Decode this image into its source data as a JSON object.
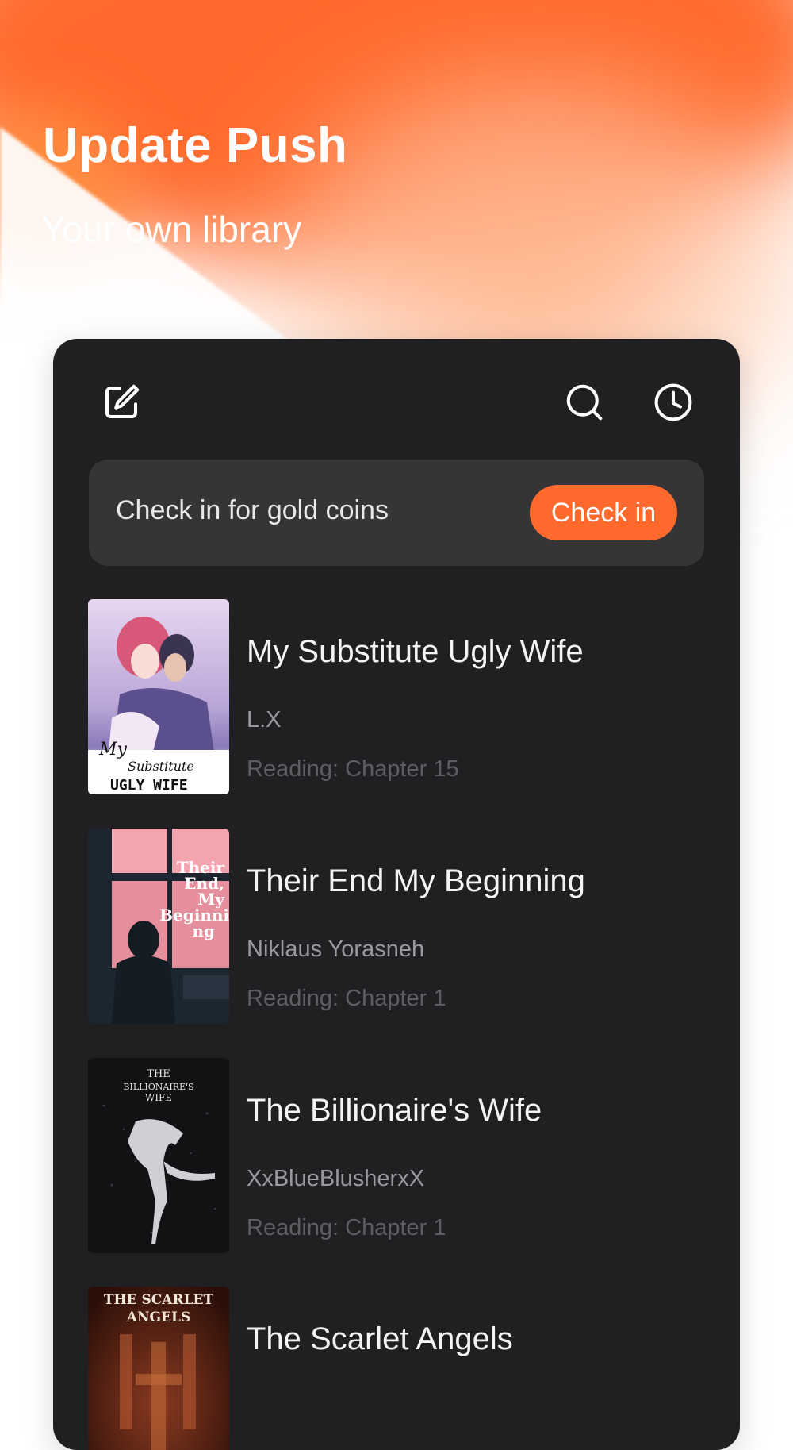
{
  "hero": {
    "title": "Update Push",
    "subtitle": "Your own library"
  },
  "toolbar": {
    "icons": [
      "edit-icon",
      "search-icon",
      "history-clock-icon"
    ]
  },
  "checkin": {
    "text": "Check in for gold coins",
    "button_label": "Check in"
  },
  "colors": {
    "accent": "#ff6a2c",
    "panel_bg": "#202022",
    "card_bg": "#353537"
  },
  "books": [
    {
      "title": "My Substitute Ugly Wife",
      "author": "L.X",
      "progress": "Reading: Chapter 15",
      "cover_text": [
        "My",
        "Substitute",
        "UGLY WIFE"
      ]
    },
    {
      "title": "Their End My Beginning",
      "author": "Niklaus Yorasneh",
      "progress": "Reading: Chapter 1",
      "cover_text": [
        "Their",
        "End,",
        "My",
        "Beginni",
        "ng"
      ]
    },
    {
      "title": "The Billionaire's Wife",
      "author": "XxBlueBlusherxX",
      "progress": "Reading: Chapter 1",
      "cover_text": [
        "THE",
        "BILLIONAIRE'S",
        "WIFE"
      ]
    },
    {
      "title": "The Scarlet Angels",
      "cover_text": [
        "THE SCARLET",
        "ANGELS"
      ]
    }
  ]
}
